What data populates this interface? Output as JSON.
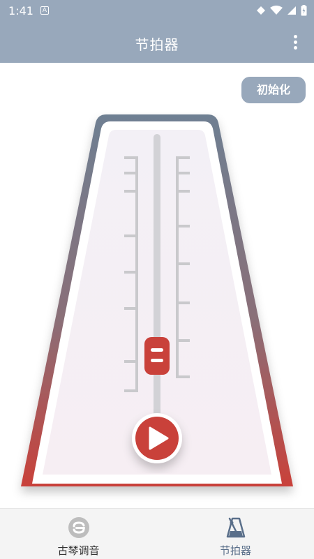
{
  "status_bar": {
    "time": "1:41",
    "notification_icon": "A"
  },
  "app_bar": {
    "title": "节拍器"
  },
  "reset_button": {
    "label": "初始化"
  },
  "metronome": {
    "slider_level": 0.2
  },
  "bottom_nav": {
    "items": [
      {
        "label": "古琴调音",
        "icon": "tuner-icon",
        "active": false
      },
      {
        "label": "节拍器",
        "icon": "metronome-icon",
        "active": true
      }
    ]
  },
  "colors": {
    "primary": "#98a8bb",
    "accent_red": "#c9413a",
    "frame_top": "#6e7f92",
    "active_nav": "#5a6f8a"
  }
}
